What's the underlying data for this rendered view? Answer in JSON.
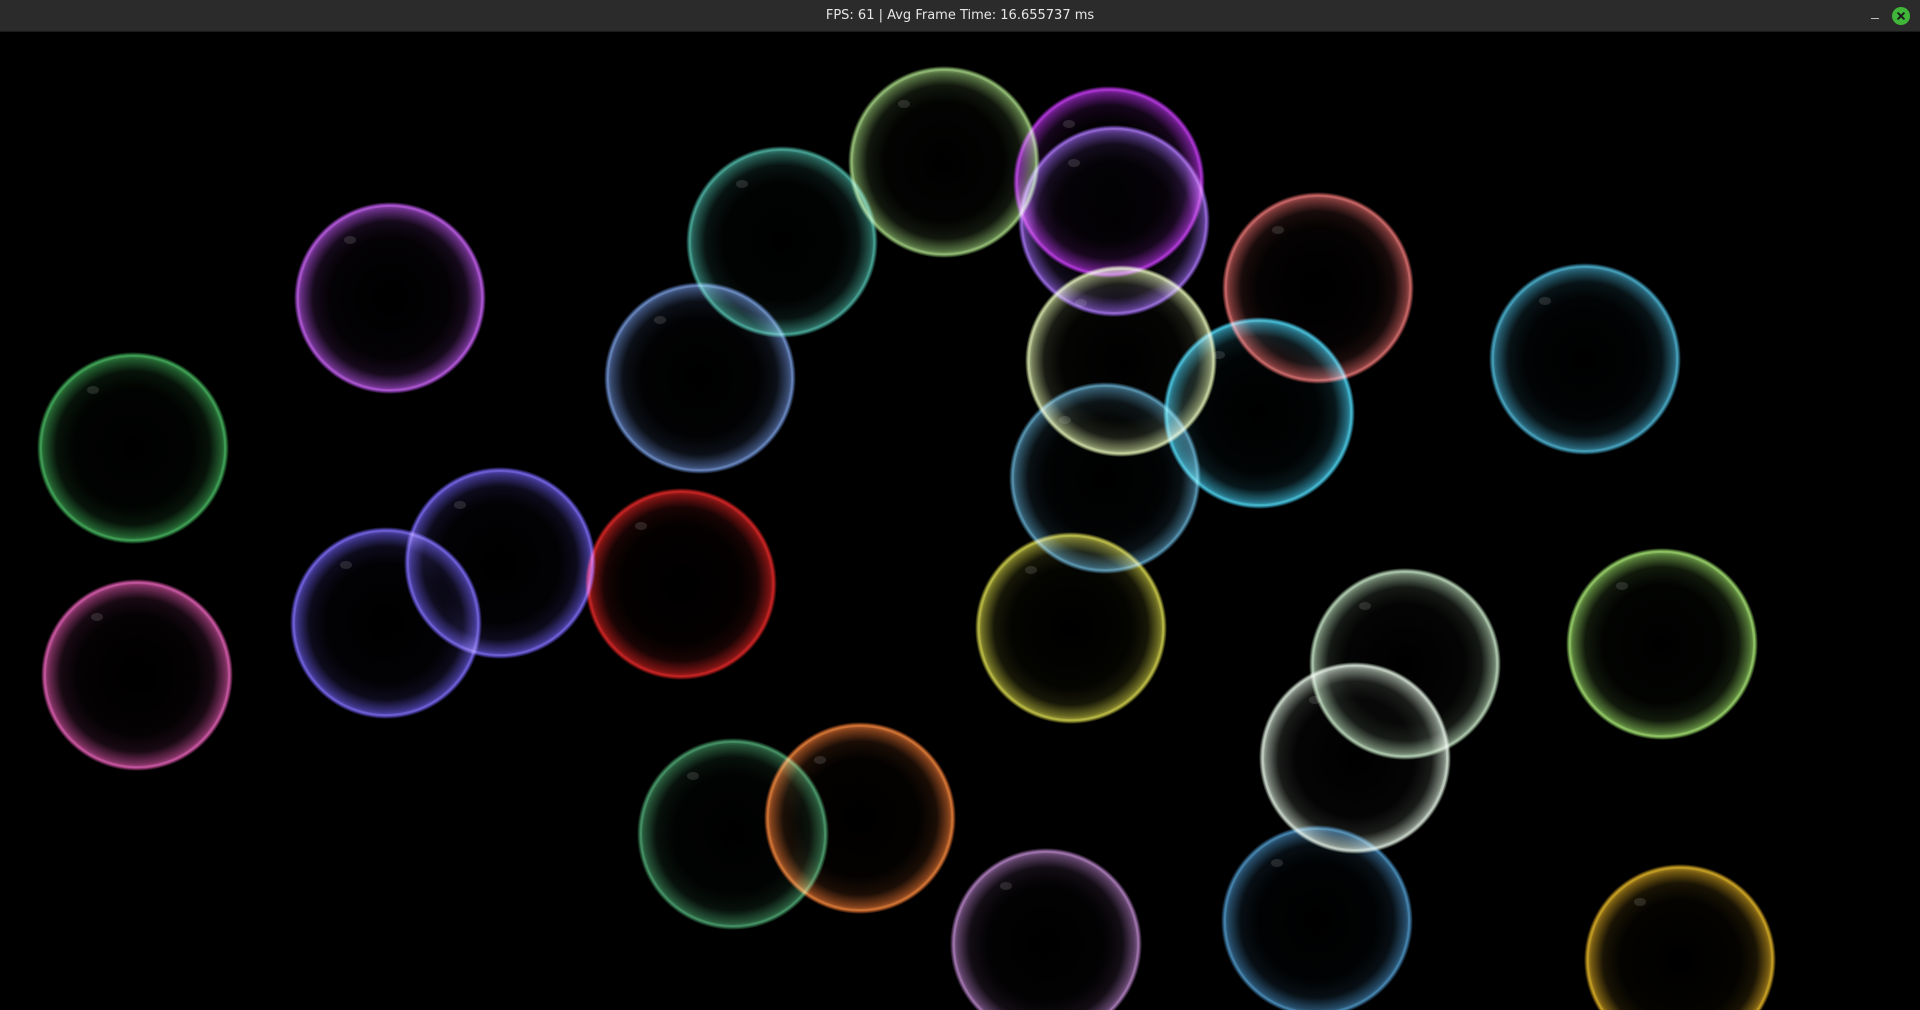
{
  "window": {
    "title": "FPS: 61 | Avg Frame Time: 16.655737 ms",
    "minimize_icon": "minimize-icon",
    "close_icon": "close-icon"
  },
  "scene": {
    "background": "#000000",
    "bubble_colors": [
      "#b050e0",
      "#3aa050",
      "#d050a0",
      "#6a5ae8",
      "#6a5ae8",
      "#d02020",
      "#6080c0",
      "#40a090",
      "#90c070",
      "#b030e0",
      "#9060e0",
      "#d06060",
      "#d0e0a0",
      "#40c0e0",
      "#5090b0",
      "#c0c040",
      "#40a0c0",
      "#b0d0b0",
      "#d0e0d0",
      "#90d060",
      "#409060",
      "#e07030",
      "#a070b0",
      "#4080b0",
      "#d0a020"
    ]
  }
}
